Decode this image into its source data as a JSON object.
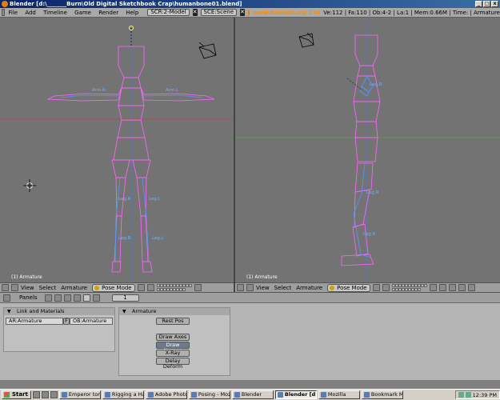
{
  "window": {
    "title": "Blender [d:\\_______Burn\\Old Digital Sketchbook Crap\\humanbone01.blend]"
  },
  "infobar": {
    "menus": [
      "File",
      "Add",
      "Timeline",
      "Game",
      "Render",
      "Help"
    ],
    "screen_field": "SCR:2-Model",
    "scene_field": "SCE:Scene",
    "url": "www.blender.org 234",
    "stats": "Ve:112 | Fa:110 | Ob:4-2 | La:1 | Mem:0.66M | Time: | Armature"
  },
  "viewports": {
    "left_label": "(1) Armature",
    "right_label": "(1) Armature",
    "left_bones": [
      "Leg.R",
      "Leg.L",
      "Leg.R",
      "Leg.L",
      "Arm.R",
      "Arm.L"
    ],
    "right_bones": [
      "Leg.R",
      "Leg.R",
      "Leg.R"
    ]
  },
  "view_header": {
    "left": {
      "view": "View",
      "select": "Select",
      "armature": "Armature",
      "mode": "Pose Mode"
    },
    "right": {
      "view": "View",
      "select": "Select",
      "armature": "Armature",
      "mode": "Pose Mode"
    }
  },
  "buttons_header": {
    "panels": "Panels",
    "frame": "1"
  },
  "link_panel": {
    "title": "Link and Materials",
    "ar_field": "AR:Armature",
    "f_label": "F",
    "ob_field": "OB:Armature"
  },
  "armature_panel": {
    "title": "Armature",
    "rest_pos": "Rest Pos",
    "draw_axes": "Draw Axes",
    "draw_names": "Draw Names",
    "xray": "X-Ray",
    "delay_deform": "Delay Deform"
  },
  "taskbar": {
    "start": "Start",
    "tasks": [
      "Emperor tomat...",
      "Rigging a Hand...",
      "Adobe Photoshop",
      "Posing - Mozilla",
      "Blender",
      "Blender [d:\\...",
      "Mozilla",
      "Bookmark Mana..."
    ],
    "clock": "12:39 PM"
  },
  "colors": {
    "bone_outline": "#ff66ff",
    "bone_label": "#6fb1ff",
    "grid_x": "#a85050",
    "grid_y": "#5a9a5a",
    "viewport_bg": "#737373"
  }
}
